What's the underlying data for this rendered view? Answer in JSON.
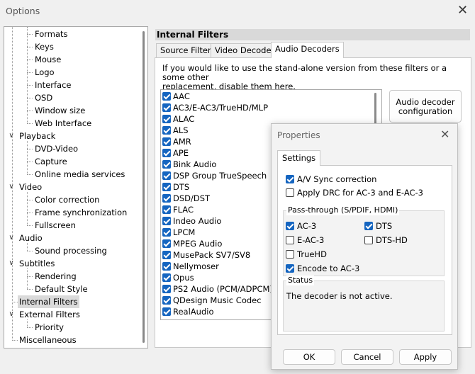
{
  "window": {
    "title": "Options"
  },
  "tree": [
    {
      "label": "Formats",
      "level": 2
    },
    {
      "label": "Keys",
      "level": 2
    },
    {
      "label": "Mouse",
      "level": 2
    },
    {
      "label": "Logo",
      "level": 2
    },
    {
      "label": "Interface",
      "level": 2
    },
    {
      "label": "OSD",
      "level": 2
    },
    {
      "label": "Window size",
      "level": 2
    },
    {
      "label": "Web Interface",
      "level": 2
    },
    {
      "label": "Playback",
      "level": 1,
      "expanded": true
    },
    {
      "label": "DVD-Video",
      "level": 2
    },
    {
      "label": "Capture",
      "level": 2
    },
    {
      "label": "Online media services",
      "level": 2
    },
    {
      "label": "Video",
      "level": 1,
      "expanded": true
    },
    {
      "label": "Color correction",
      "level": 2
    },
    {
      "label": "Frame synchronization",
      "level": 2
    },
    {
      "label": "Fullscreen",
      "level": 2
    },
    {
      "label": "Audio",
      "level": 1,
      "expanded": true
    },
    {
      "label": "Sound processing",
      "level": 2
    },
    {
      "label": "Subtitles",
      "level": 1,
      "expanded": true
    },
    {
      "label": "Rendering",
      "level": 2
    },
    {
      "label": "Default Style",
      "level": 2
    },
    {
      "label": "Internal Filters",
      "level": 1,
      "selected": true
    },
    {
      "label": "External Filters",
      "level": 1,
      "expanded": true
    },
    {
      "label": "Priority",
      "level": 2
    },
    {
      "label": "Miscellaneous",
      "level": 1
    }
  ],
  "panel": {
    "header": "Internal Filters",
    "tabs": [
      {
        "label": "Source Filters",
        "active": false
      },
      {
        "label": "Video Decoders",
        "active": false
      },
      {
        "label": "Audio Decoders",
        "active": true
      }
    ],
    "description_line1": "If you would like to use the stand-alone version from these filters or a some other",
    "description_line2": "replacement, disable them here.",
    "config_button_line1": "Audio decoder",
    "config_button_line2": "configuration",
    "filters": [
      {
        "label": "AAC",
        "checked": true
      },
      {
        "label": "AC3/E-AC3/TrueHD/MLP",
        "checked": true
      },
      {
        "label": "ALAC",
        "checked": true
      },
      {
        "label": "ALS",
        "checked": true
      },
      {
        "label": "AMR",
        "checked": true
      },
      {
        "label": "APE",
        "checked": true
      },
      {
        "label": "Bink Audio",
        "checked": true
      },
      {
        "label": "DSP Group TrueSpeech",
        "checked": true
      },
      {
        "label": "DTS",
        "checked": true
      },
      {
        "label": "DSD/DST",
        "checked": true
      },
      {
        "label": "FLAC",
        "checked": true
      },
      {
        "label": "Indeo Audio",
        "checked": true
      },
      {
        "label": "LPCM",
        "checked": true
      },
      {
        "label": "MPEG Audio",
        "checked": true
      },
      {
        "label": "MusePack SV7/SV8",
        "checked": true
      },
      {
        "label": "Nellymoser",
        "checked": true
      },
      {
        "label": "Opus",
        "checked": true
      },
      {
        "label": "PS2 Audio (PCM/ADPCM)",
        "checked": true
      },
      {
        "label": "QDesign Music Codec",
        "checked": true
      },
      {
        "label": "RealAudio",
        "checked": true
      }
    ]
  },
  "dialog": {
    "title": "Properties",
    "tab": "Settings",
    "av_sync": {
      "label": "A/V Sync correction",
      "checked": true
    },
    "apply_drc": {
      "label": "Apply DRC for AC-3 and E-AC-3",
      "checked": false
    },
    "passthrough": {
      "label": "Pass-through (S/PDIF, HDMI)",
      "ac3": {
        "label": "AC-3",
        "checked": true
      },
      "dts": {
        "label": "DTS",
        "checked": true
      },
      "eac3": {
        "label": "E-AC-3",
        "checked": false
      },
      "dtshd": {
        "label": "DTS-HD",
        "checked": false
      },
      "truehd": {
        "label": "TrueHD",
        "checked": false
      },
      "encode": {
        "label": "Encode to AC-3",
        "checked": true
      }
    },
    "status": {
      "label": "Status",
      "text": "The decoder is not active."
    },
    "buttons": {
      "ok": "OK",
      "cancel": "Cancel",
      "apply": "Apply"
    }
  },
  "colors": {
    "accent": "#1565c0",
    "selection": "#dadada",
    "header": "#d9d9d9"
  }
}
